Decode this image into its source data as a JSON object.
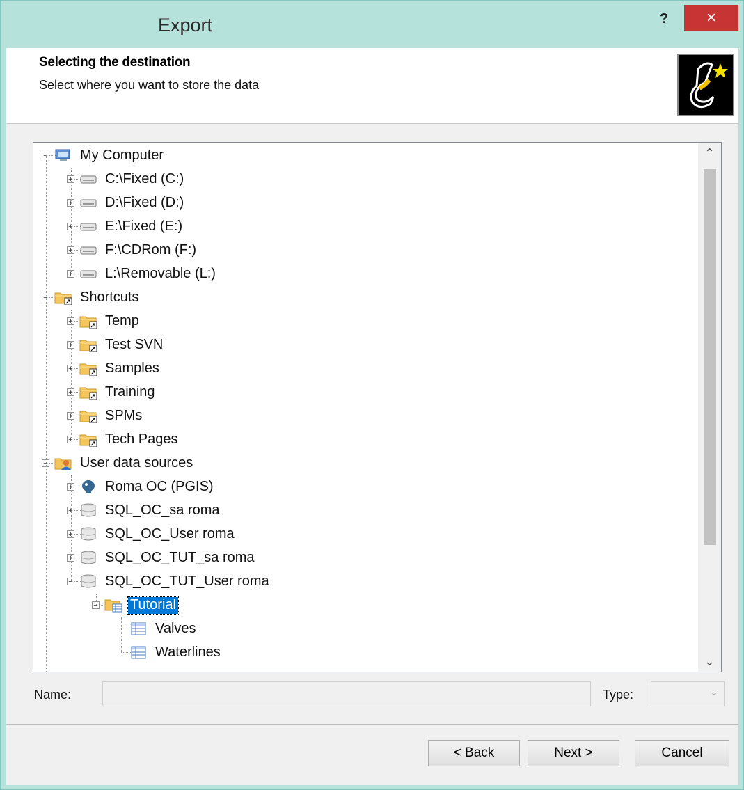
{
  "window": {
    "title": "Export",
    "help_label": "?",
    "close_label": "×"
  },
  "header": {
    "title": "Selecting the destination",
    "subtitle": "Select where you want to store the data",
    "icon": "wizard-icon"
  },
  "tree": {
    "items": [
      {
        "label": "My Computer",
        "level": 0,
        "icon": "computer-icon",
        "expander": "minus"
      },
      {
        "label": "C:\\Fixed (C:)",
        "level": 1,
        "icon": "drive-icon",
        "expander": "plus"
      },
      {
        "label": "D:\\Fixed (D:)",
        "level": 1,
        "icon": "drive-icon",
        "expander": "plus"
      },
      {
        "label": "E:\\Fixed (E:)",
        "level": 1,
        "icon": "drive-icon",
        "expander": "plus"
      },
      {
        "label": "F:\\CDRom (F:)",
        "level": 1,
        "icon": "drive-icon",
        "expander": "plus"
      },
      {
        "label": "L:\\Removable (L:)",
        "level": 1,
        "icon": "drive-icon",
        "expander": "plus"
      },
      {
        "label": "Shortcuts",
        "level": 0,
        "icon": "shortcut-folder-icon",
        "expander": "minus"
      },
      {
        "label": "Temp",
        "level": 1,
        "icon": "shortcut-folder-icon",
        "expander": "plus"
      },
      {
        "label": "Test SVN",
        "level": 1,
        "icon": "shortcut-folder-icon",
        "expander": "plus"
      },
      {
        "label": "Samples",
        "level": 1,
        "icon": "shortcut-folder-icon",
        "expander": "plus"
      },
      {
        "label": "Training",
        "level": 1,
        "icon": "shortcut-folder-icon",
        "expander": "plus"
      },
      {
        "label": "SPMs",
        "level": 1,
        "icon": "shortcut-folder-icon",
        "expander": "plus"
      },
      {
        "label": "Tech Pages",
        "level": 1,
        "icon": "shortcut-folder-icon",
        "expander": "plus"
      },
      {
        "label": "User data sources",
        "level": 0,
        "icon": "user-folder-icon",
        "expander": "minus"
      },
      {
        "label": "Roma OC (PGIS)",
        "level": 1,
        "icon": "postgres-icon",
        "expander": "plus"
      },
      {
        "label": "SQL_OC_sa roma",
        "level": 1,
        "icon": "database-icon",
        "expander": "plus"
      },
      {
        "label": "SQL_OC_User roma",
        "level": 1,
        "icon": "database-icon",
        "expander": "plus"
      },
      {
        "label": "SQL_OC_TUT_sa roma",
        "level": 1,
        "icon": "database-icon",
        "expander": "plus"
      },
      {
        "label": "SQL_OC_TUT_User roma",
        "level": 1,
        "icon": "database-icon",
        "expander": "minus"
      },
      {
        "label": "Tutorial",
        "level": 2,
        "icon": "table-folder-icon",
        "expander": "minus",
        "selected": true
      },
      {
        "label": "Valves",
        "level": 3,
        "icon": "table-icon",
        "expander": "none"
      },
      {
        "label": "Waterlines",
        "level": 3,
        "icon": "table-icon",
        "expander": "none"
      }
    ]
  },
  "form": {
    "name_label": "Name:",
    "name_value": "",
    "type_label": "Type:",
    "type_value": ""
  },
  "buttons": {
    "back": "< Back",
    "next": "Next >",
    "cancel": "Cancel"
  },
  "colors": {
    "titlebar": "#b6e2dc",
    "close": "#c73434",
    "selection": "#0078d7"
  }
}
